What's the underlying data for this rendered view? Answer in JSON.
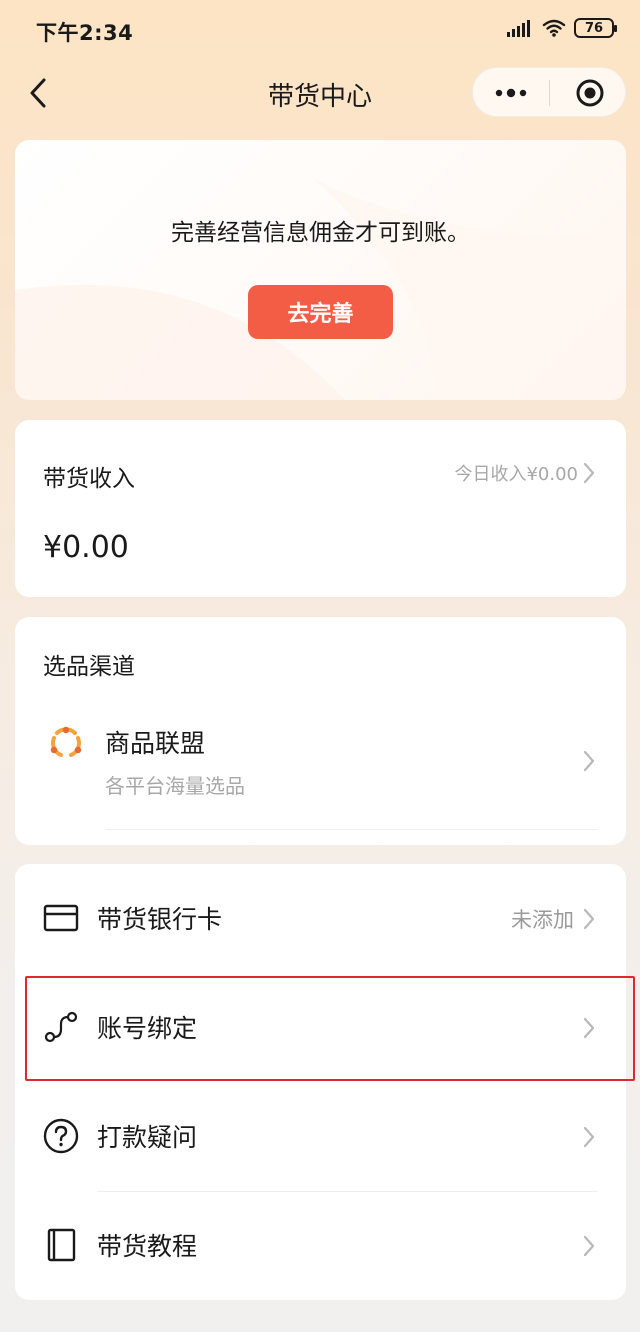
{
  "status_bar": {
    "time": "下午2:34",
    "battery": "76"
  },
  "nav": {
    "title": "带货中心"
  },
  "notice": {
    "text": "完善经营信息佣金才可到账。",
    "button": "去完善"
  },
  "income": {
    "title": "带货收入",
    "today": "今日收入¥0.00",
    "amount": "¥0.00"
  },
  "channel": {
    "title": "选品渠道",
    "item": {
      "name": "商品联盟",
      "subtitle": "各平台海量选品",
      "icon": "alliance-icon"
    }
  },
  "menu": [
    {
      "label": "带货银行卡",
      "value": "未添加",
      "icon": "bank-card-icon"
    },
    {
      "label": "账号绑定",
      "value": "",
      "icon": "link-icon"
    },
    {
      "label": "打款疑问",
      "value": "",
      "icon": "help-icon"
    },
    {
      "label": "带货教程",
      "value": "",
      "icon": "book-icon"
    }
  ],
  "colors": {
    "accent": "#f45d45",
    "highlight": "#e0282e",
    "alliance_orange": "#f4a340"
  }
}
